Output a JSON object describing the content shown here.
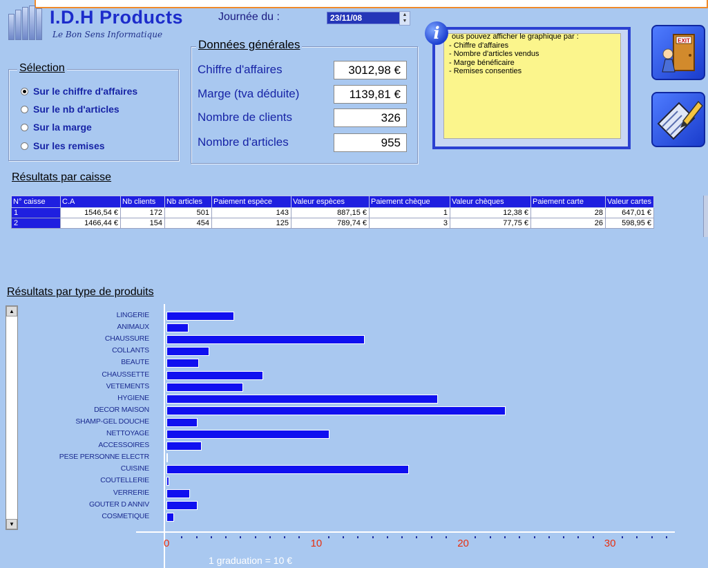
{
  "app": {
    "title": "I.D.H Products",
    "subtitle": "Le Bon Sens Informatique"
  },
  "date": {
    "label": "Journée du :",
    "value": "23/11/08"
  },
  "selection": {
    "title": "Sélection",
    "options": [
      {
        "label": "Sur le chiffre d'affaires",
        "checked": true
      },
      {
        "label": "Sur le nb d'articles",
        "checked": false
      },
      {
        "label": "Sur la marge",
        "checked": false
      },
      {
        "label": "Sur les remises",
        "checked": false
      }
    ]
  },
  "general": {
    "title": "Données générales",
    "rows": [
      {
        "label": "Chiffre d'affaires",
        "value": "3012,98 €"
      },
      {
        "label": "Marge (tva déduite)",
        "value": "1139,81 €"
      },
      {
        "label": "Nombre de clients",
        "value": "326"
      },
      {
        "label": "Nombre d'articles",
        "value": "955"
      }
    ]
  },
  "info": {
    "intro": "ous pouvez afficher le graphique par :",
    "items": [
      "- Chiffre d'affaires",
      "- Nombre d'articles vendus",
      "- Marge bénéficaire",
      "- Remises consenties"
    ]
  },
  "buttons": {
    "exit_label": "EXIT"
  },
  "caisse": {
    "title": "Résultats par caisse",
    "columns": [
      "N° caisse",
      "C.A",
      "Nb clients",
      "Nb articles",
      "Paiement espèce",
      "Valeur espèces",
      "Paiement chèque",
      "Valeur chèques",
      "Paiement carte",
      "Valeur cartes"
    ],
    "rows": [
      [
        "1",
        "1546,54 €",
        "172",
        "501",
        "143",
        "887,15 €",
        "1",
        "12,38 €",
        "28",
        "647,01 €"
      ],
      [
        "2",
        "1466,44 €",
        "154",
        "454",
        "125",
        "789,74 €",
        "3",
        "77,75 €",
        "26",
        "598,95 €"
      ]
    ]
  },
  "products": {
    "title": "Résultats par type de produits",
    "graduation_note": "1 graduation = 10 €"
  },
  "chart_data": {
    "type": "bar",
    "orientation": "horizontal",
    "categories": [
      "LINGERIE",
      "ANIMAUX",
      "CHAUSSURE",
      "COLLANTS",
      "BEAUTE",
      "CHAUSSETTE",
      "VETEMENTS",
      "HYGIENE",
      "DECOR MAISON",
      "SHAMP-GEL DOUCHE",
      "NETTOYAGE",
      "ACCESSOIRES",
      "PESE PERSONNE ELECTR",
      "CUISINE",
      "COUTELLERIE",
      "VERRERIE",
      "GOUTER D ANNIV",
      "COSMETIQUE"
    ],
    "values": [
      46,
      15,
      135,
      29,
      22,
      66,
      52,
      185,
      231,
      21,
      111,
      24,
      0.5,
      165,
      2,
      16,
      21,
      5
    ],
    "xlim": [
      0,
      350
    ],
    "tick_labels": [
      "0",
      "10",
      "20",
      "30"
    ],
    "tick_values": [
      0,
      100,
      200,
      300
    ],
    "minor_step": 10,
    "bar_color": "#1010f0"
  }
}
